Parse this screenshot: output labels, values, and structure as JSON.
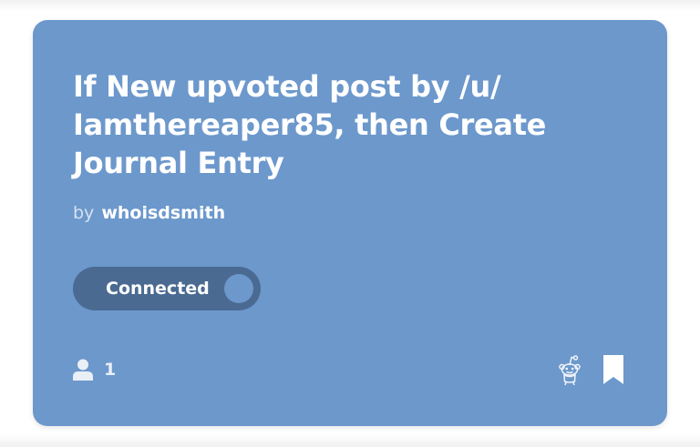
{
  "applet": {
    "title": "If New upvoted post by /u/ Iamthereaper85, then Create Journal Entry",
    "by_label": "by",
    "author": "whoisdsmith",
    "toggle_label": "Connected",
    "users_count": "1",
    "colors": {
      "card": "#6c98cc",
      "toggle": "#4a6a92"
    },
    "icons": {
      "users": "user-icon",
      "service": "reddit-icon",
      "save": "bookmark-icon"
    }
  }
}
